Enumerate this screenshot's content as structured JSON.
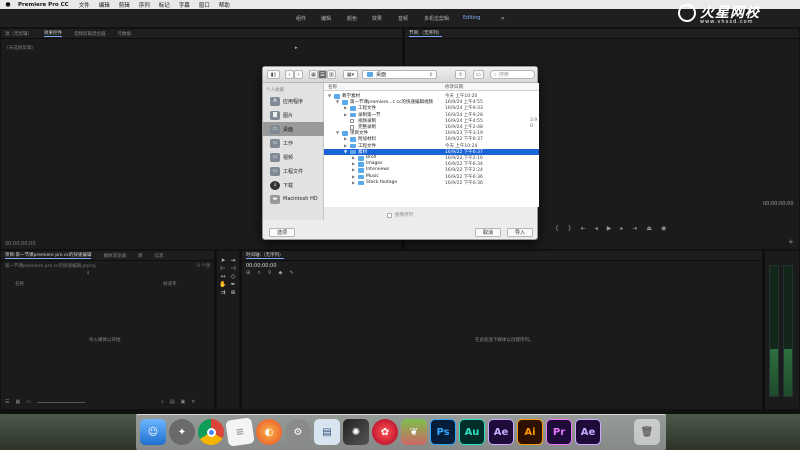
{
  "menubar": {
    "app_name": "Premiere Pro CC",
    "items": [
      "文件",
      "编辑",
      "剪辑",
      "序列",
      "标记",
      "字幕",
      "窗口",
      "帮助"
    ]
  },
  "workspace": {
    "tabs": [
      "组件",
      "编辑",
      "颜色",
      "效果",
      "音频",
      "多机位剪辑",
      "Editing"
    ],
    "active_tab": "Editing"
  },
  "watermark": {
    "name": "火星网校",
    "url": "www.vhxsd.com"
  },
  "effect_controls": {
    "tabs": [
      "源（无剪辑）",
      "效果控件",
      "音频剪辑混合器",
      "元数据"
    ],
    "empty_text": "(未选择剪辑)",
    "timecode": "00;00;00;00"
  },
  "program": {
    "tab": "节目:（无序列）",
    "timecode": "00;00;00;00"
  },
  "project": {
    "tabs": [
      "项目:第一节课premiere pro cc的快速编辑",
      "媒体浏览器",
      "库",
      "信息"
    ],
    "file": "第一节课premiere pro cc的快速编辑.prproj",
    "item_count": "0 个项",
    "col_name": "名称",
    "col_rate": "帧速率",
    "empty_text": "导入媒体以开始"
  },
  "timeline": {
    "tab": "时间轴:（无序列）",
    "timecode": "00;00;00;00",
    "empty_text": "在此处放下媒体以创建序列。"
  },
  "dialog": {
    "path": "桌面",
    "search_placeholder": "搜索",
    "sidebar_header": "个人收藏",
    "sidebar_items": [
      "应用程序",
      "图片",
      "桌面",
      "工作",
      "视频",
      "工程文件",
      "下载",
      "Macintosh HD"
    ],
    "active_sidebar": "桌面",
    "columns": {
      "name": "名称",
      "date": "修改日期"
    },
    "rows": [
      {
        "name": "教学素材",
        "date": "今天 上午10:20",
        "size": "",
        "level": 0,
        "open": true,
        "kind": "folder"
      },
      {
        "name": "第一节课premiere...c cc的快速编辑视频",
        "date": "16/9/24 上午4:55",
        "size": "",
        "level": 1,
        "open": true,
        "kind": "folder"
      },
      {
        "name": "工程文件",
        "date": "16/9/24 上午9:33",
        "size": "",
        "level": 2,
        "open": false,
        "kind": "folder"
      },
      {
        "name": "录制第一节",
        "date": "16/9/24 上午9:28",
        "size": "",
        "level": 2,
        "open": false,
        "kind": "folder"
      },
      {
        "name": "视频录制",
        "date": "16/9/24 上午4:55",
        "size": "3.9",
        "level": 2,
        "open": false,
        "kind": "doc"
      },
      {
        "name": "完整录制",
        "date": "16/9/24 上午2:48",
        "size": "0",
        "level": 2,
        "open": false,
        "kind": "doc"
      },
      {
        "name": "项目文件",
        "date": "16/9/23 下午3:19",
        "size": "",
        "level": 1,
        "open": true,
        "kind": "folder"
      },
      {
        "name": "附加材料",
        "date": "16/9/22 下午6:37",
        "size": "",
        "level": 2,
        "open": false,
        "kind": "folder"
      },
      {
        "name": "工程文件",
        "date": "今天 上午10:24",
        "size": "",
        "level": 2,
        "open": false,
        "kind": "folder"
      },
      {
        "name": "素材",
        "date": "16/9/22 下午6:37",
        "size": "",
        "level": 2,
        "open": true,
        "kind": "folder",
        "selected": true
      },
      {
        "name": "Broll",
        "date": "16/9/22 下午2:16",
        "size": "",
        "level": 3,
        "open": false,
        "kind": "folder"
      },
      {
        "name": "Images",
        "date": "16/9/22 下午6:34",
        "size": "",
        "level": 3,
        "open": false,
        "kind": "folder"
      },
      {
        "name": "Interviews",
        "date": "16/9/22 下午2:24",
        "size": "",
        "level": 3,
        "open": false,
        "kind": "folder"
      },
      {
        "name": "Music",
        "date": "16/9/22 下午6:36",
        "size": "",
        "level": 3,
        "open": false,
        "kind": "folder"
      },
      {
        "name": "Stock footage",
        "date": "16/9/22 下午6:36",
        "size": "",
        "level": 3,
        "open": false,
        "kind": "folder"
      }
    ],
    "sequence_checkbox": "图像序列",
    "options_button": "选项",
    "cancel_button": "取消",
    "import_button": "导入"
  },
  "dock": {
    "apps": [
      "Finder",
      "Launchpad",
      "Chrome",
      "Notes",
      "Firefox",
      "System Preferences",
      "Preview",
      "Final Cut Pro",
      "DaVinci Resolve",
      "Fruit",
      "Ps",
      "Au",
      "Ae",
      "Ai",
      "Pr",
      "Ae",
      "Trash"
    ]
  }
}
